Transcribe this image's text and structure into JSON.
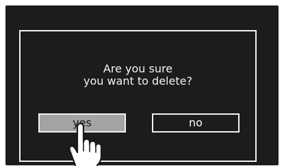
{
  "dialog": {
    "message_line1": "Are you sure",
    "message_line2": "you want to delete?",
    "yes_label": "yes",
    "no_label": "no"
  },
  "colors": {
    "screen_background": "#1c1c1c",
    "border": "#f2f2f2",
    "yes_button_fill": "#a3a3a3",
    "text": "#f4f4f4"
  },
  "icons": {
    "pointer": "pointing-hand-icon"
  }
}
